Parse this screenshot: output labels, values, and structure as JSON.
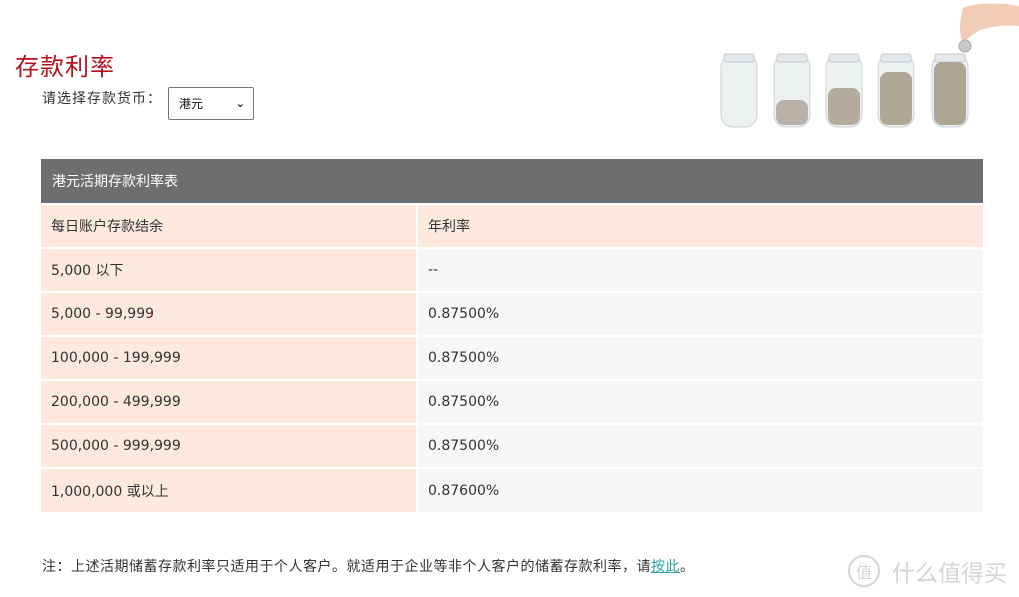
{
  "page_title": "存款利率",
  "currency": {
    "label": "请选择存款货币：",
    "selected": "港元"
  },
  "table": {
    "title": "港元活期存款利率表",
    "columns": [
      "每日账户存款结余",
      "年利率"
    ],
    "rows": [
      {
        "balance": "5,000 以下",
        "rate": "--"
      },
      {
        "balance": "5,000 - 99,999",
        "rate": "0.87500%"
      },
      {
        "balance": "100,000 - 199,999",
        "rate": "0.87500%"
      },
      {
        "balance": "200,000 - 499,999",
        "rate": "0.87500%"
      },
      {
        "balance": "500,000 - 999,999",
        "rate": "0.87500%"
      },
      {
        "balance": "1,000,000 或以上",
        "rate": "0.87600%"
      }
    ]
  },
  "note": {
    "text": "注：上述活期储蓄存款利率只适用于个人客户。就适用于企业等非个人客户的储蓄存款利率，请",
    "link": "按此",
    "end": "。"
  },
  "watermark": {
    "badge": "值",
    "text": "什么值得买"
  },
  "colors": {
    "title": "#b5121b",
    "table_header": "#6d6e70",
    "balance_cell": "#fde9de",
    "rate_cell": "#f7f7f7",
    "link": "#2a9d9d"
  }
}
